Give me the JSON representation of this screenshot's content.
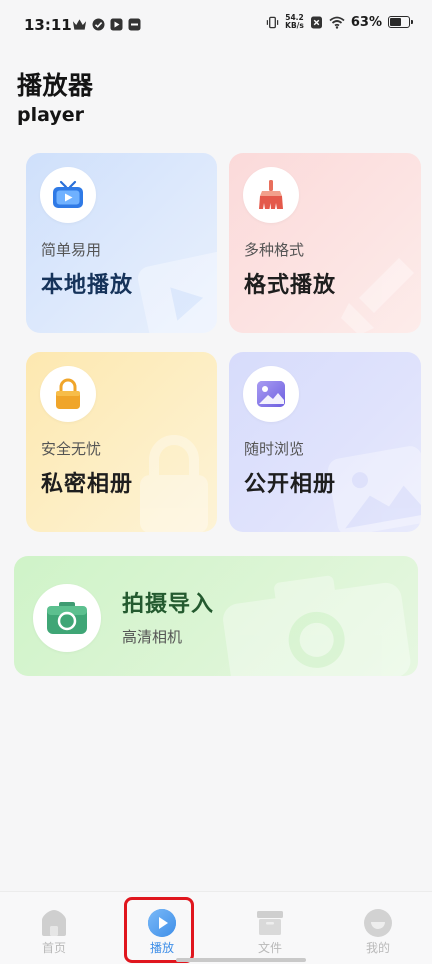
{
  "status_bar": {
    "time": "13:11",
    "net_speed_value": "54.2",
    "net_speed_unit": "KB/s",
    "battery_percent": "63%",
    "battery_level": 0.63,
    "left_icons": [
      "crown-icon",
      "check-circle-icon",
      "play-square-icon",
      "app-square-icon"
    ],
    "right_icons": [
      "vibrate-icon",
      "close-square-icon",
      "wifi-icon",
      "battery-icon"
    ]
  },
  "header": {
    "title": "播放器",
    "subtitle": "player"
  },
  "cards": {
    "local_play": {
      "small": "简单易用",
      "big": "本地播放",
      "icon": "tv-icon"
    },
    "format_play": {
      "small": "多种格式",
      "big": "格式播放",
      "icon": "broom-icon"
    },
    "private_album": {
      "small": "安全无忧",
      "big": "私密相册",
      "icon": "lock-icon"
    },
    "public_album": {
      "small": "随时浏览",
      "big": "公开相册",
      "icon": "photo-icon"
    },
    "camera_import": {
      "big": "拍摄导入",
      "small": "高清相机",
      "icon": "camera-icon"
    }
  },
  "bottom_nav": {
    "items": [
      {
        "label": "首页",
        "icon": "home-icon",
        "active": false
      },
      {
        "label": "播放",
        "icon": "play-icon",
        "active": true
      },
      {
        "label": "文件",
        "icon": "folder-icon",
        "active": false
      },
      {
        "label": "我的",
        "icon": "profile-icon",
        "active": false
      }
    ]
  },
  "colors": {
    "accent": "#3f8fe8",
    "highlight": "#e0161e"
  }
}
